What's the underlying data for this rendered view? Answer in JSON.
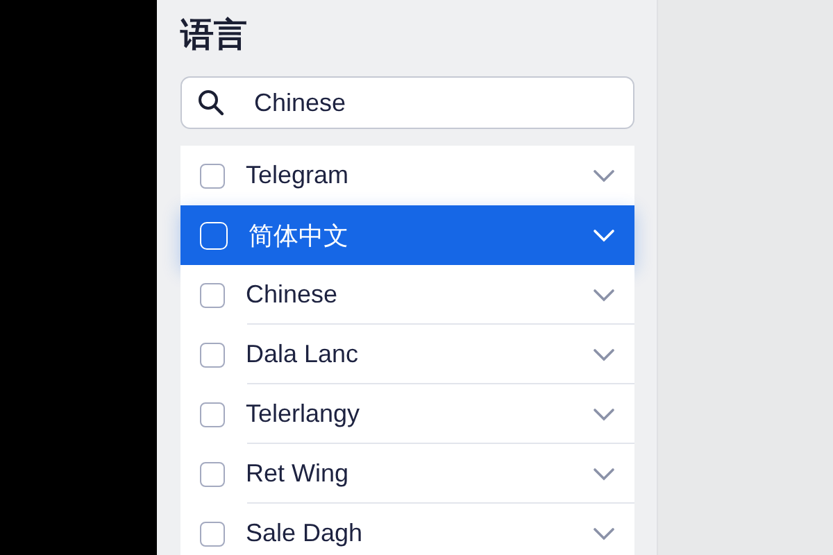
{
  "title": "语言",
  "search": {
    "value": "Chinese"
  },
  "languages": [
    {
      "label": "Telegram",
      "selected": false,
      "checked": false
    },
    {
      "label": "简体中文",
      "selected": true,
      "checked": false
    },
    {
      "label": "Chinese",
      "selected": false,
      "checked": false
    },
    {
      "label": "Dala Lanc",
      "selected": false,
      "checked": false
    },
    {
      "label": "Telerlangy",
      "selected": false,
      "checked": false
    },
    {
      "label": "Ret Wing",
      "selected": false,
      "checked": false
    },
    {
      "label": "Sale Dagh",
      "selected": false,
      "checked": false
    }
  ]
}
